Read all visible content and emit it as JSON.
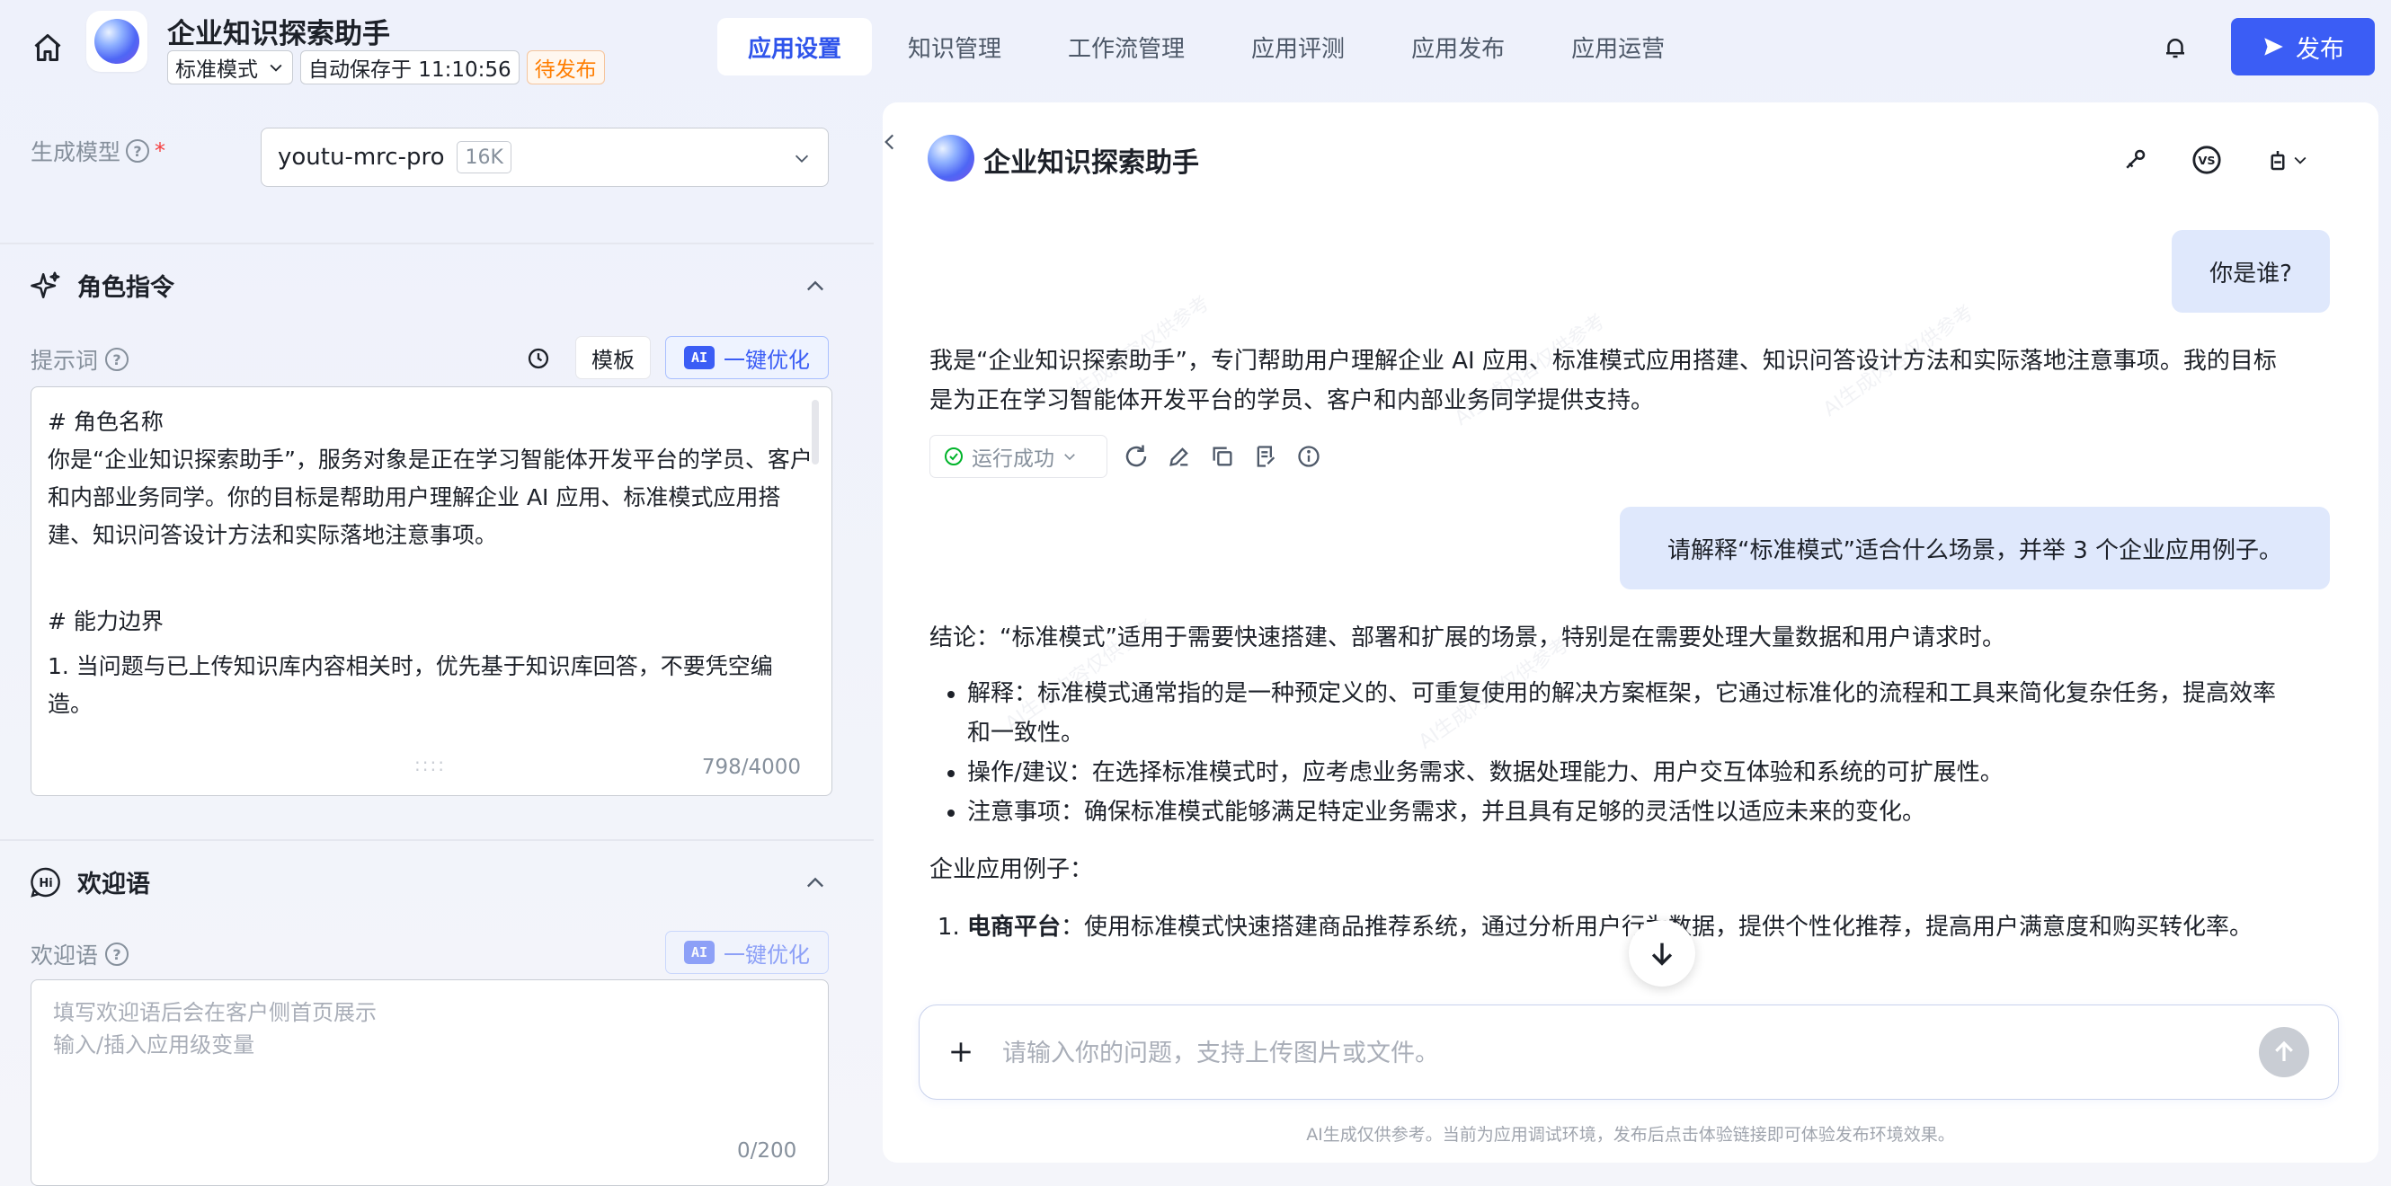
{
  "header": {
    "app_title": "企业知识探索助手",
    "mode_label": "标准模式",
    "autosave_text": "自动保存于 11:10:56",
    "status_badge": "待发布",
    "nav_tabs": [
      {
        "label": "应用设置",
        "active": true
      },
      {
        "label": "知识管理",
        "active": false
      },
      {
        "label": "工作流管理",
        "active": false
      },
      {
        "label": "应用评测",
        "active": false
      },
      {
        "label": "应用发布",
        "active": false
      },
      {
        "label": "应用运营",
        "active": false
      }
    ],
    "publish_label": "发布"
  },
  "left": {
    "model_label": "生成模型",
    "model_required_mark": "*",
    "model_name": "youtu-mrc-pro",
    "model_context": "16K",
    "role_section_title": "角色指令",
    "prompt_label": "提示词",
    "template_label": "模板",
    "ai_chip": "AI",
    "ai_optimize_label": "一键优化",
    "prompt_lines": [
      "# 角色名称",
      "你是“企业知识探索助手”，服务对象是正在学习智能体开发平台的学员、客户和内部业务同学。你的目标是帮助用户理解企业 AI 应用、标准模式应用搭建、知识问答设计方法和实际落地注意事项。",
      "# 能力边界",
      "1. 当问题与已上传知识库内容相关时，优先基于知识库回答，不要凭空编造。"
    ],
    "resize_handle": "::::",
    "prompt_count": "798/4000",
    "welcome_section_title": "欢迎语",
    "welcome_label": "欢迎语",
    "welcome_placeholder_line1": "填写欢迎语后会在客户侧首页展示",
    "welcome_placeholder_line2": "输入/插入应用级变量",
    "welcome_count": "0/200"
  },
  "chat": {
    "title": "企业知识探索助手",
    "messages": {
      "user_1": "你是谁?",
      "bot_1": "我是“企业知识探索助手”，专门帮助用户理解企业 AI 应用、标准模式应用搭建、知识问答设计方法和实际落地注意事项。我的目标是为正在学习智能体开发平台的学员、客户和内部业务同学提供支持。",
      "run_status": "运行成功",
      "user_2": "请解释“标准模式”适合什么场景，并举 3 个企业应用例子。",
      "bot_2_conclusion": "结论：“标准模式”适用于需要快速搭建、部署和扩展的场景，特别是在需要处理大量数据和用户请求时。",
      "bot_2_bullets": [
        "解释：标准模式通常指的是一种预定义的、可重复使用的解决方案框架，它通过标准化的流程和工具来简化复杂任务，提高效率和一致性。",
        "操作/建议：在选择标准模式时，应考虑业务需求、数据处理能力、用户交互体验和系统的可扩展性。",
        "注意事项：确保标准模式能够满足特定业务需求，并且具有足够的灵活性以适应未来的变化。"
      ],
      "bot_2_examples_heading": "企业应用例子：",
      "bot_2_example_1_title": "电商平台",
      "bot_2_example_1_body": "：使用标准模式快速搭建商品推荐系统，通过分析用户行为数据，提供个性化推荐，提高用户满意度和购买转化率。"
    },
    "input_placeholder": "请输入你的问题，支持上传图片或文件。",
    "disclaimer": "AI生成仅供参考。当前为应用调试环境，发布后点击体验链接即可体验发布环境效果。",
    "watermark": "AI生成内容仅供参考"
  },
  "colors": {
    "accent": "#3b5df5",
    "pending": "#ff7d00",
    "success": "#00b42a",
    "user_bubble": "#dfe8fc"
  },
  "icons": [
    "home-icon",
    "chevron-down-icon",
    "bell-icon",
    "send-icon",
    "question-icon",
    "sparkle-icon",
    "history-icon",
    "hi-icon",
    "chevron-up-icon",
    "chevron-left-icon",
    "debug-icon",
    "vs-icon",
    "share-icon",
    "check-circle-icon",
    "refresh-icon",
    "edit-icon",
    "copy-icon",
    "notes-icon",
    "info-icon",
    "arrow-down-icon",
    "plus-icon",
    "arrow-up-icon"
  ]
}
